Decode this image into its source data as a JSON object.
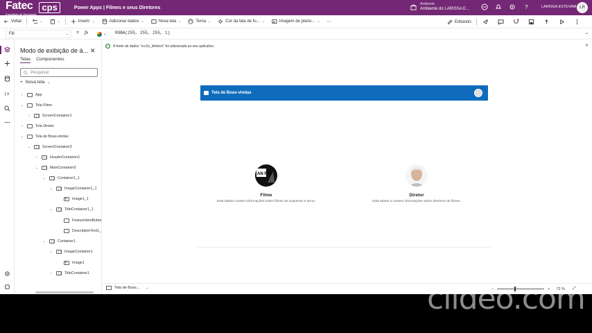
{
  "header": {
    "logo_main": "Fatec",
    "logo_sub": "Faculdade de Tecnologia",
    "logo_secondary": "cps",
    "app_title": "Power Apps  |  Filmes e seus Diretores",
    "env_label": "Ambiente",
    "env_name": "Ambiente do LARISSA E...",
    "user_name": "LARISSA ESTEVAM...",
    "avatar_initials": "LR"
  },
  "commandbar": {
    "back": "Voltar",
    "insert": "Inserir",
    "add_data": "Adicionar dados",
    "new_screen": "Nova tela",
    "theme": "Tema",
    "bg_color": "Cor da tela de fu...",
    "bg_image": "Imagem de plano...",
    "editing": "Editando"
  },
  "formula": {
    "property": "Fill",
    "equals": "=",
    "fx": "fx",
    "value": "RGBA(255, 255, 255, 1)"
  },
  "tree": {
    "title": "Modo de exibição de á...",
    "tab_screens": "Telas",
    "tab_components": "Componentes",
    "search_placeholder": "Pesquisar",
    "new_screen": "Nova tela",
    "nodes": [
      {
        "label": "App"
      },
      {
        "label": "Tela Filme"
      },
      {
        "label": "ScreenContainer1"
      },
      {
        "label": "Tela Diretor"
      },
      {
        "label": "Tela de Boas-vindas"
      },
      {
        "label": "ScreenContainer3"
      },
      {
        "label": "HeaderContainer1"
      },
      {
        "label": "MainContainer3"
      },
      {
        "label": "Container1_1"
      },
      {
        "label": "ImageContainer1_1"
      },
      {
        "label": "Image1_1"
      },
      {
        "label": "TitleContainer1_1"
      },
      {
        "label": "FeatureItemButtor"
      },
      {
        "label": "DescriptionText1_"
      },
      {
        "label": "Container1"
      },
      {
        "label": "ImageContainer1"
      },
      {
        "label": "Image1"
      },
      {
        "label": "TitleContainer1"
      }
    ]
  },
  "canvas": {
    "notice": "A fonte de dados \"crc1b_diretors\" foi adicionada ao seu aplicativo.",
    "screen_header": "Tela de Boas-vindas",
    "card1_title": "Filme",
    "card1_desc": "Esta tabela contem informações sobre filmes de suspense e terror.",
    "card1_img_text": "AN RINO",
    "card2_title": "Diretor",
    "card2_desc": "Esta tabela a contem informações sobre diretores de filmes."
  },
  "status": {
    "screen": "Tela de Boas...",
    "zoom_minus": "−",
    "zoom_plus": "+",
    "zoom_value": "72 %",
    "zoom_level": 0.38
  },
  "watermark": "clideo.com"
}
